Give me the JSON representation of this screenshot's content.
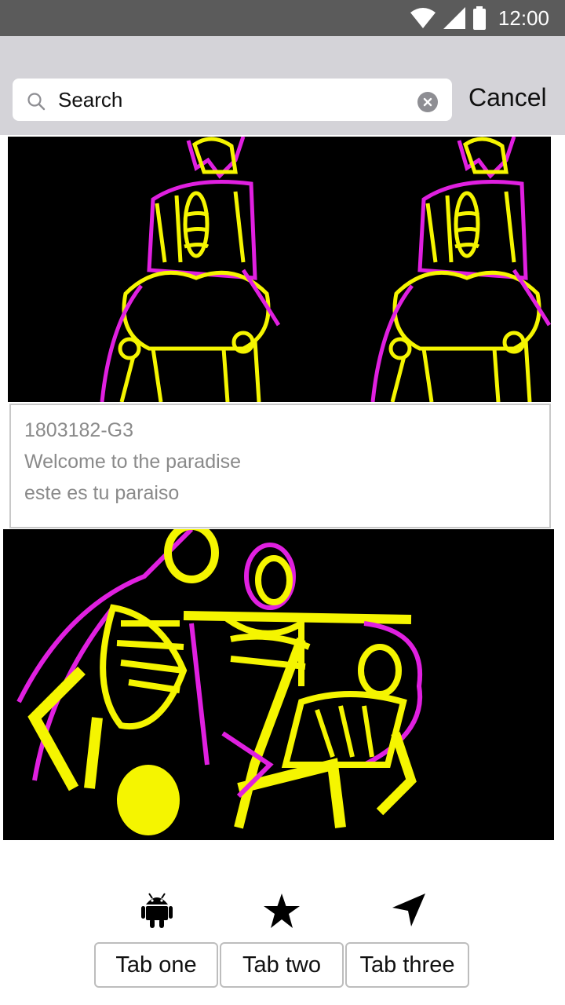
{
  "status_bar": {
    "time": "12:00"
  },
  "search": {
    "placeholder": "Search",
    "cancel_label": "Cancel"
  },
  "card": {
    "code": "1803182-G3",
    "line1": "Welcome to the paradise",
    "line2": "este es tu paraiso"
  },
  "tabs": [
    {
      "label": "Tab one",
      "icon": "android-icon"
    },
    {
      "label": "Tab two",
      "icon": "star-icon"
    },
    {
      "label": "Tab three",
      "icon": "navigation-arrow-icon"
    }
  ],
  "colors": {
    "artwork_yellow": "#f5f500",
    "artwork_magenta": "#e020e0",
    "header_bg": "#d4d3d8"
  }
}
